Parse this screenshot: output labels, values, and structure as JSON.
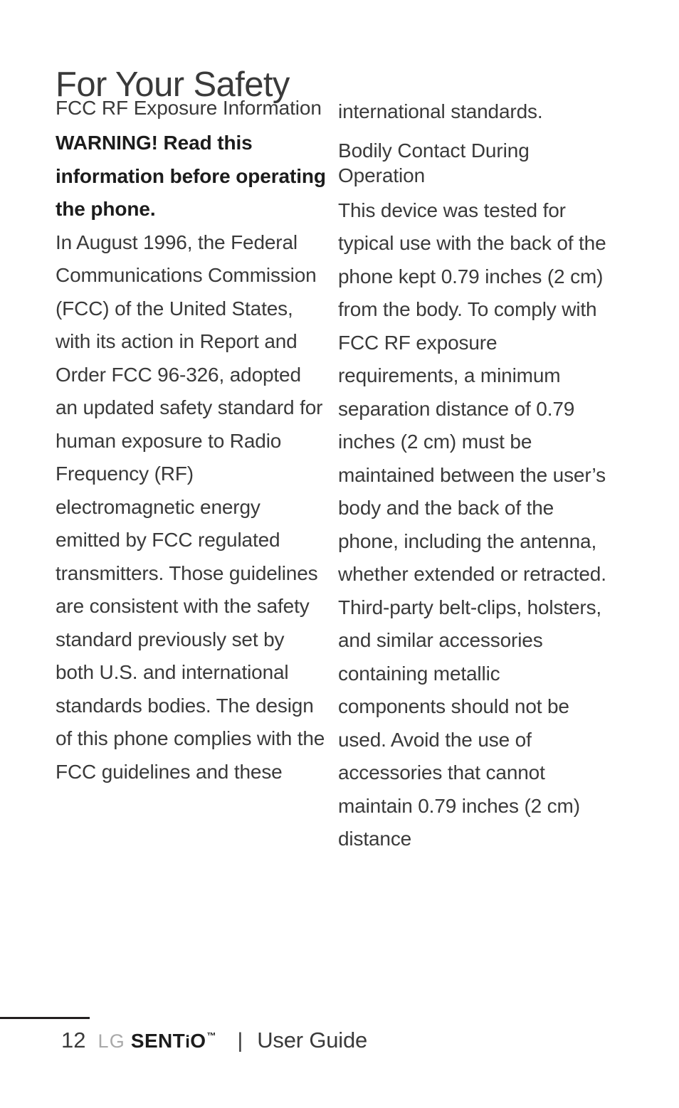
{
  "document": {
    "title": "For Your Safety",
    "left_column": {
      "subheading": "FCC RF Exposure Information",
      "warning": "WARNING! Read this information before operating the phone.",
      "paragraph": "In August 1996, the Federal Communications Commission (FCC) of the United States, with its action in Report and Order FCC 96-326, adopted an updated safety standard for human exposure to Radio Frequency (RF) electromagnetic energy emitted by FCC regulated transmitters. Those guidelines are consistent with the safety standard previously set by both U.S. and international standards bodies. The design of this phone complies with the FCC guidelines and these"
    },
    "right_column": {
      "continuation": "international standards.",
      "subheading": "Bodily Contact During Operation",
      "paragraph": "This device was tested for typical use with the back of the phone kept 0.79 inches (2 cm) from the body. To comply with FCC RF exposure requirements, a minimum separation distance of 0.79 inches (2 cm) must be maintained between the user’s body and the back of the phone, including the antenna, whether extended or retracted. Third-party belt-clips, holsters, and similar accessories containing metallic components should not be used. Avoid the use of accessories that cannot maintain 0.79 inches (2 cm) distance"
    },
    "footer": {
      "page_number": "12",
      "brand_lg": "LG",
      "brand_model_prefix": "SENT",
      "brand_model_i": "i",
      "brand_model_suffix": "O",
      "trademark": "™",
      "separator": "|",
      "guide_label": "User Guide"
    },
    "colors": {
      "body_text": "#3a3a3a",
      "bold_text": "#1c1c1c",
      "brand_lg": "#a9a9a9",
      "rule": "#221f1f",
      "background": "#ffffff"
    }
  }
}
